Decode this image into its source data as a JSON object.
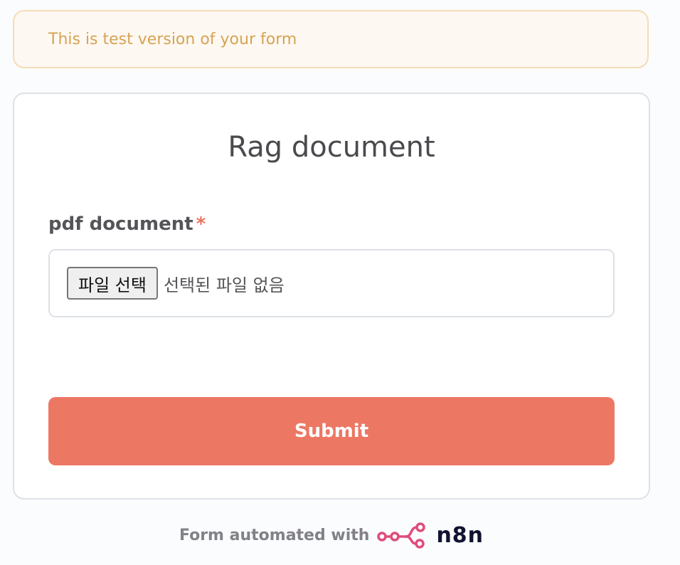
{
  "banner": {
    "text": "This is test version of your form"
  },
  "form": {
    "title": "Rag document",
    "field": {
      "label": "pdf document",
      "required_marker": "*",
      "file_button_label": "파일 선택",
      "file_status": "선택된 파일 없음"
    },
    "submit_label": "Submit"
  },
  "footer": {
    "text": "Form automated with",
    "logo_wordmark": "n8n",
    "logo_icon": "n8n-logo-icon"
  },
  "colors": {
    "accent": "#ec7864",
    "banner_text": "#d5a453",
    "banner_border": "#f4dcb6",
    "logo_pink": "#e04c7a"
  }
}
